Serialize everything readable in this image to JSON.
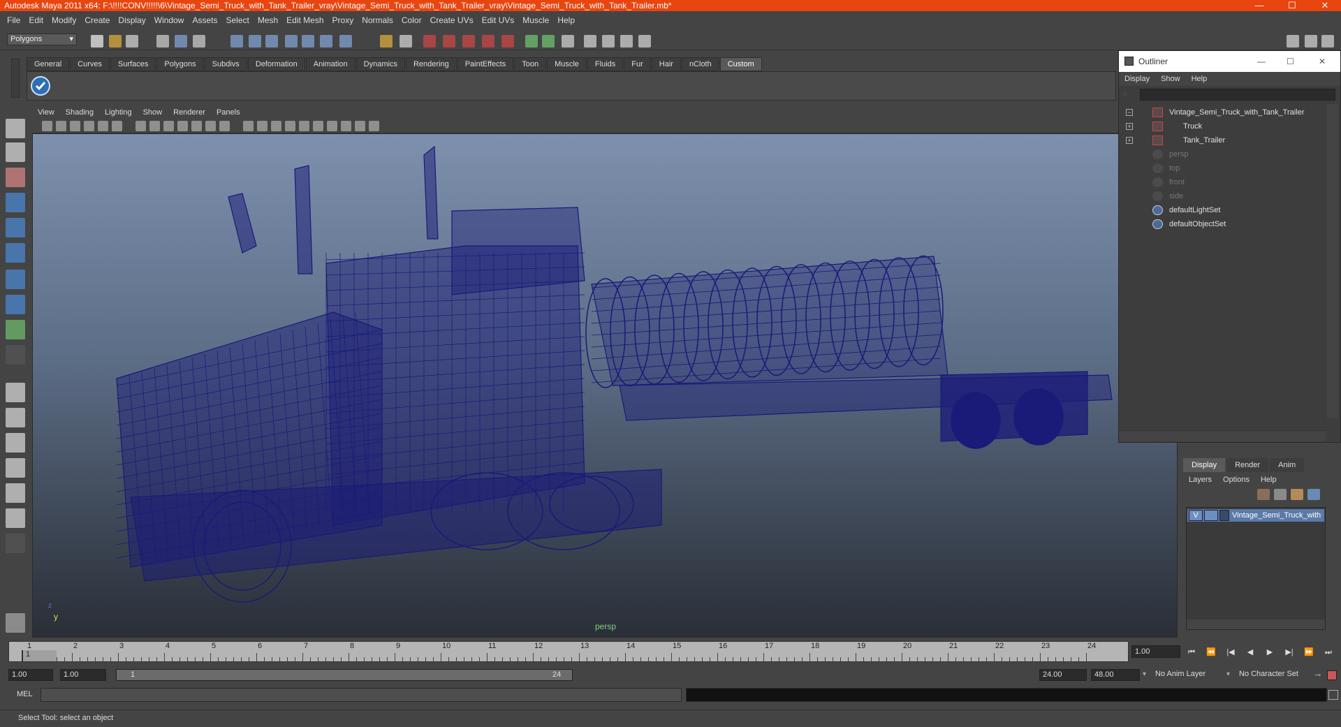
{
  "window": {
    "title": "Autodesk Maya 2011 x64: F:\\!!!!CONV!!!!!\\6\\Vintage_Semi_Truck_with_Tank_Trailer_vray\\Vintage_Semi_Truck_with_Tank_Trailer_vray\\Vintage_Semi_Truck_with_Tank_Trailer.mb*",
    "minimize": "—",
    "maximize": "☐",
    "close": "✕"
  },
  "menubar": [
    "File",
    "Edit",
    "Modify",
    "Create",
    "Display",
    "Window",
    "Assets",
    "Select",
    "Mesh",
    "Edit Mesh",
    "Proxy",
    "Normals",
    "Color",
    "Create UVs",
    "Edit UVs",
    "Muscle",
    "Help"
  ],
  "statusline": {
    "mode": "Polygons"
  },
  "shelf": {
    "tabs": [
      "General",
      "Curves",
      "Surfaces",
      "Polygons",
      "Subdivs",
      "Deformation",
      "Animation",
      "Dynamics",
      "Rendering",
      "PaintEffects",
      "Toon",
      "Muscle",
      "Fluids",
      "Fur",
      "Hair",
      "nCloth",
      "Custom"
    ],
    "active_tab": "Custom"
  },
  "viewport": {
    "menu": [
      "View",
      "Shading",
      "Lighting",
      "Show",
      "Renderer",
      "Panels"
    ],
    "camera_label": "persp",
    "axis_y": "y",
    "axis_z": "z",
    "wire_color": "#1a1a78",
    "bg_top": "#7d90ad",
    "bg_bottom": "#2a2f37"
  },
  "outliner": {
    "title": "Outliner",
    "menu": [
      "Display",
      "Show",
      "Help"
    ],
    "items": [
      {
        "label": "Vintage_Semi_Truck_with_Tank_Trailer",
        "icon": "transform-icon",
        "expander": "−",
        "dim": false
      },
      {
        "label": "Truck",
        "icon": "transform-icon",
        "expander": "+",
        "dim": false
      },
      {
        "label": "Tank_Trailer",
        "icon": "transform-icon",
        "expander": "+",
        "dim": false
      },
      {
        "label": "persp",
        "icon": "camera-icon",
        "expander": "",
        "dim": true
      },
      {
        "label": "top",
        "icon": "camera-icon",
        "expander": "",
        "dim": true
      },
      {
        "label": "front",
        "icon": "camera-icon",
        "expander": "",
        "dim": true
      },
      {
        "label": "side",
        "icon": "camera-icon",
        "expander": "",
        "dim": true
      },
      {
        "label": "defaultLightSet",
        "icon": "set-icon",
        "expander": "",
        "dim": false
      },
      {
        "label": "defaultObjectSet",
        "icon": "set-icon",
        "expander": "",
        "dim": false
      }
    ]
  },
  "layers": {
    "tabs": [
      "Display",
      "Render",
      "Anim"
    ],
    "active_tab": "Display",
    "menu": [
      "Layers",
      "Options",
      "Help"
    ],
    "layer": {
      "visible": "V",
      "name": "Vintage_Semi_Truck_with"
    }
  },
  "timeslider": {
    "ticks": [
      "1",
      "2",
      "3",
      "4",
      "5",
      "6",
      "7",
      "8",
      "9",
      "10",
      "11",
      "12",
      "13",
      "14",
      "15",
      "16",
      "17",
      "18",
      "19",
      "20",
      "21",
      "22",
      "23",
      "24"
    ],
    "current_frame_marker": "1",
    "current_frame": "1.00"
  },
  "playback": [
    "⏮",
    "⏪",
    "|◀",
    "◀",
    "▶",
    "▶|",
    "⏩",
    "⏭"
  ],
  "range": {
    "start": "1.00",
    "anim_start": "1.00",
    "slider_start": "1",
    "slider_end": "24",
    "end": "24.00",
    "anim_end": "48.00",
    "anim_layer": "No Anim Layer",
    "character_set": "No Character Set"
  },
  "mel": {
    "label": "MEL"
  },
  "helpline": "Select Tool: select an object"
}
